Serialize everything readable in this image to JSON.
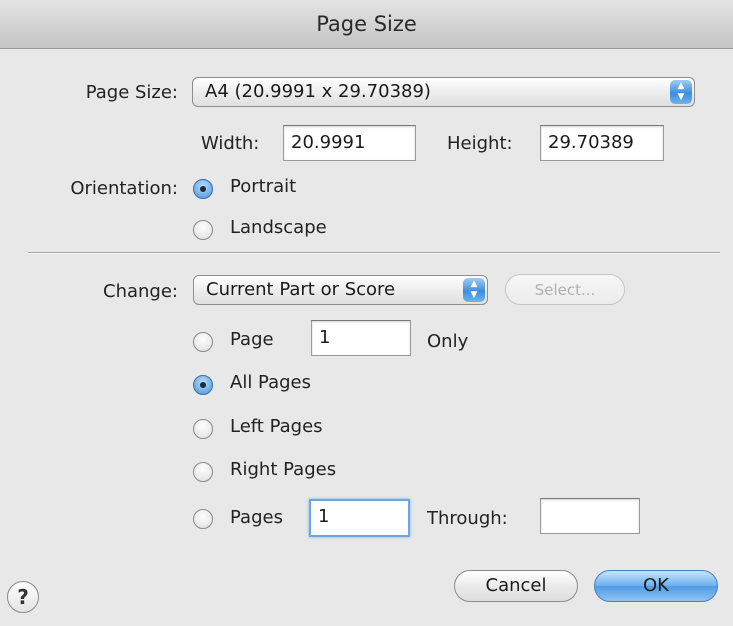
{
  "window": {
    "title": "Page Size"
  },
  "page_size": {
    "label": "Page Size:",
    "selected": "A4 (20.9991 x 29.70389)",
    "width_label": "Width:",
    "width_value": "20.9991",
    "height_label": "Height:",
    "height_value": "29.70389"
  },
  "orientation": {
    "label": "Orientation:",
    "options": [
      "Portrait",
      "Landscape"
    ],
    "selected": "Portrait"
  },
  "change": {
    "label": "Change:",
    "selected": "Current Part or Score",
    "select_button": "Select...",
    "page_option": "Page",
    "page_value": "1",
    "page_only": "Only",
    "all_pages": "All Pages",
    "left_pages": "Left Pages",
    "right_pages": "Right Pages",
    "pages_option": "Pages",
    "pages_from": "1",
    "through_label": "Through:",
    "pages_to": "",
    "selected_option": "All Pages"
  },
  "buttons": {
    "help": "?",
    "cancel": "Cancel",
    "ok": "OK"
  },
  "icons": {
    "popup_arrows": "up-down-chevron-icon",
    "help": "help-icon"
  }
}
